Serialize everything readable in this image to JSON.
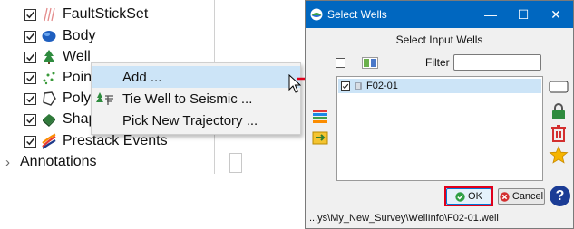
{
  "tree": {
    "items": [
      {
        "label": "FaultStickSet",
        "icon": "fault-stick-icon",
        "checked": true
      },
      {
        "label": "Body",
        "icon": "body-icon",
        "checked": true
      },
      {
        "label": "Well",
        "icon": "well-icon",
        "checked": true
      },
      {
        "label": "Point",
        "icon": "pointset-icon",
        "checked": true
      },
      {
        "label": "Polyg",
        "icon": "polygon-icon",
        "checked": true
      },
      {
        "label": "Shap",
        "icon": "shapefile-icon",
        "checked": true
      },
      {
        "label": "Prestack Events",
        "icon": "prestack-events-icon",
        "checked": true
      }
    ],
    "annotations_label": "Annotations",
    "expand_glyph": "›"
  },
  "context_menu": {
    "items": [
      {
        "label": "Add ...",
        "highlighted": true,
        "icon": ""
      },
      {
        "label": "Tie Well to Seismic ...",
        "highlighted": false,
        "icon": "tie-well-icon"
      },
      {
        "label": "Pick New Trajectory ...",
        "highlighted": false,
        "icon": ""
      }
    ]
  },
  "dialog": {
    "title": "Select Wells",
    "heading": "Select Input Wells",
    "filter_label": "Filter",
    "filter_value": "",
    "wells": [
      {
        "name": "F02-01",
        "checked": true,
        "selected": true
      }
    ],
    "ok_label": "OK",
    "cancel_label": "Cancel",
    "help_label": "?",
    "status_path": "...ys\\My_New_Survey\\WellInfo\\F02-01.well",
    "titlebar_buttons": {
      "minimize": "—",
      "maximize": "☐",
      "close": "✕"
    }
  },
  "colors": {
    "titlebar": "#0067c0",
    "selection": "#cce4f7",
    "highlight_border": "#e0001b",
    "arrow": "#e0001b"
  }
}
